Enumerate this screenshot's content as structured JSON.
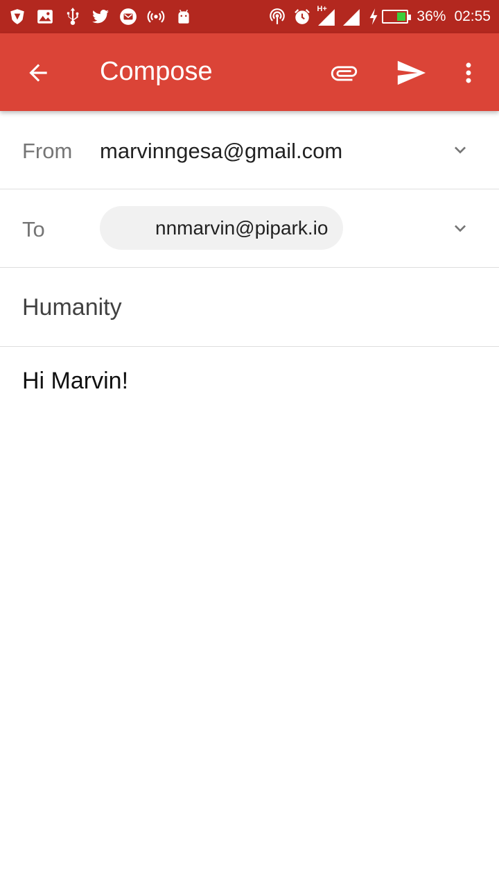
{
  "status_bar": {
    "battery_percent": "36%",
    "battery_level": 0.36,
    "time": "02:55",
    "network_label": "H+",
    "left_icons": [
      "shield-v-icon",
      "image-icon",
      "usb-icon",
      "twitter-icon",
      "mail-icon",
      "broadcast-icon",
      "android-icon"
    ],
    "right_icons": [
      "hotspot-icon",
      "alarm-icon",
      "signal-h-icon",
      "signal-icon",
      "charging-icon",
      "battery-icon"
    ],
    "colors": {
      "background": "#b3281f",
      "battery_fill": "#3ccf3c"
    }
  },
  "app_bar": {
    "title": "Compose",
    "icons": [
      "back-arrow-icon",
      "attach-icon",
      "send-icon",
      "more-vert-icon"
    ],
    "color": "#db4437"
  },
  "compose": {
    "from_label": "From",
    "from_value": "marvinngesa@gmail.com",
    "to_label": "To",
    "to_recipient": "nnmarvin@pipark.io",
    "subject": "Humanity",
    "body": "Hi Marvin!"
  }
}
